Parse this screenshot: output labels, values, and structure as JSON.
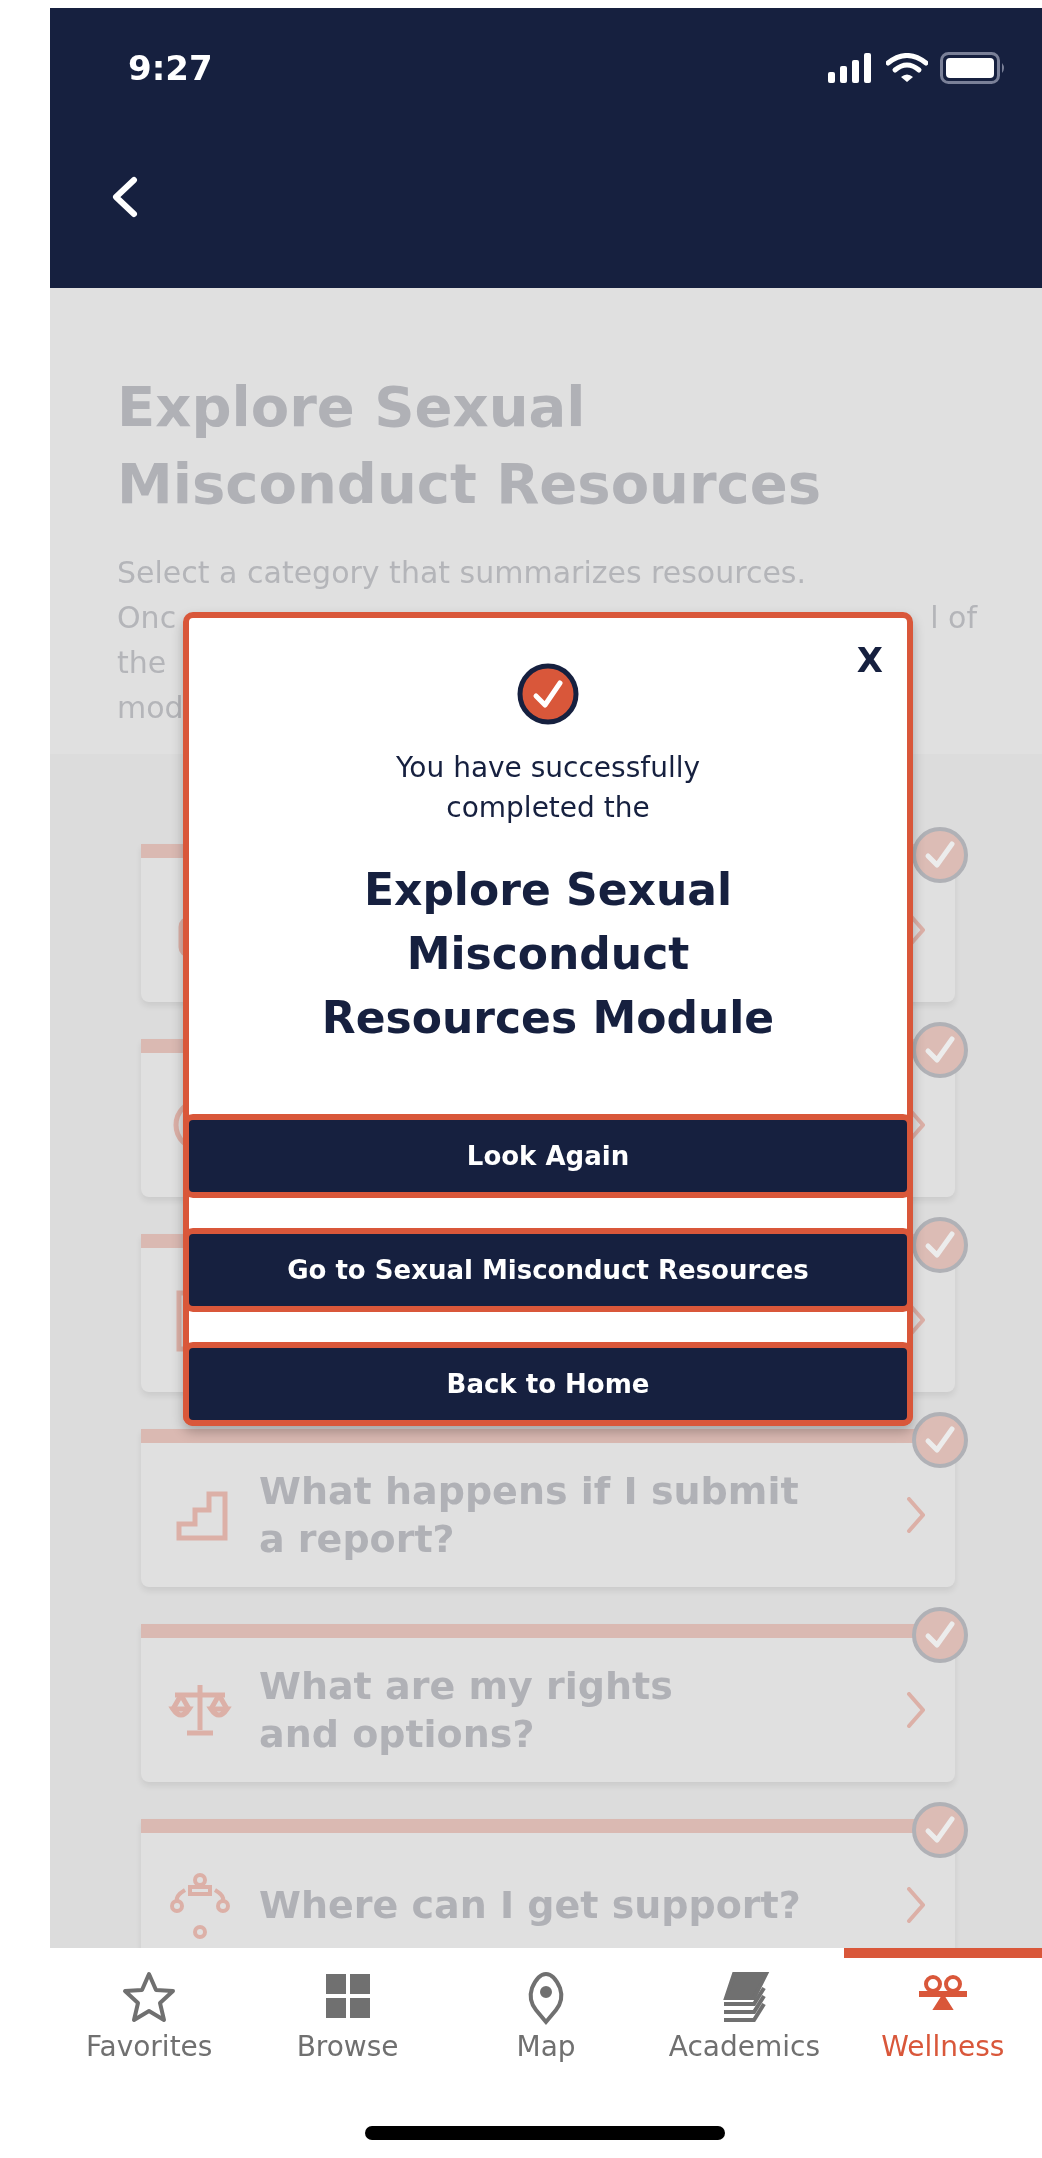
{
  "status_bar": {
    "time": "9:27"
  },
  "page": {
    "title": "Explore Sexual Misconduct Resources",
    "subtitle_lines": [
      [
        "Select a category that summarizes resources."
      ],
      [
        "Onc",
        "l of"
      ],
      [
        "the"
      ],
      [
        "mod"
      ]
    ]
  },
  "cards": [
    {
      "kind": "hand",
      "completed": true
    },
    {
      "kind": "info",
      "completed": true
    },
    {
      "kind": "document",
      "completed": true
    },
    {
      "kind": "stairs",
      "completed": true,
      "title_lines": [
        "What happens if I submit",
        "a report?"
      ]
    },
    {
      "kind": "scales",
      "completed": true,
      "title_lines": [
        "What are my rights",
        "and options?"
      ]
    },
    {
      "kind": "network",
      "completed": true,
      "title_lines": [
        "Where can I get support?"
      ]
    }
  ],
  "modal": {
    "close": "X",
    "message": "You have successfully completed the",
    "title": "Explore Sexual Misconduct Resources Module",
    "buttons": [
      "Look Again",
      "Go to Sexual Misconduct Resources",
      "Back to Home"
    ]
  },
  "tabs": [
    {
      "kind": "star",
      "label": "Favorites",
      "selected": false
    },
    {
      "kind": "grid",
      "label": "Browse",
      "selected": false
    },
    {
      "kind": "pin",
      "label": "Map",
      "selected": false
    },
    {
      "kind": "books",
      "label": "Academics",
      "selected": false
    },
    {
      "kind": "seesaw",
      "label": "Wellness",
      "selected": true
    }
  ]
}
